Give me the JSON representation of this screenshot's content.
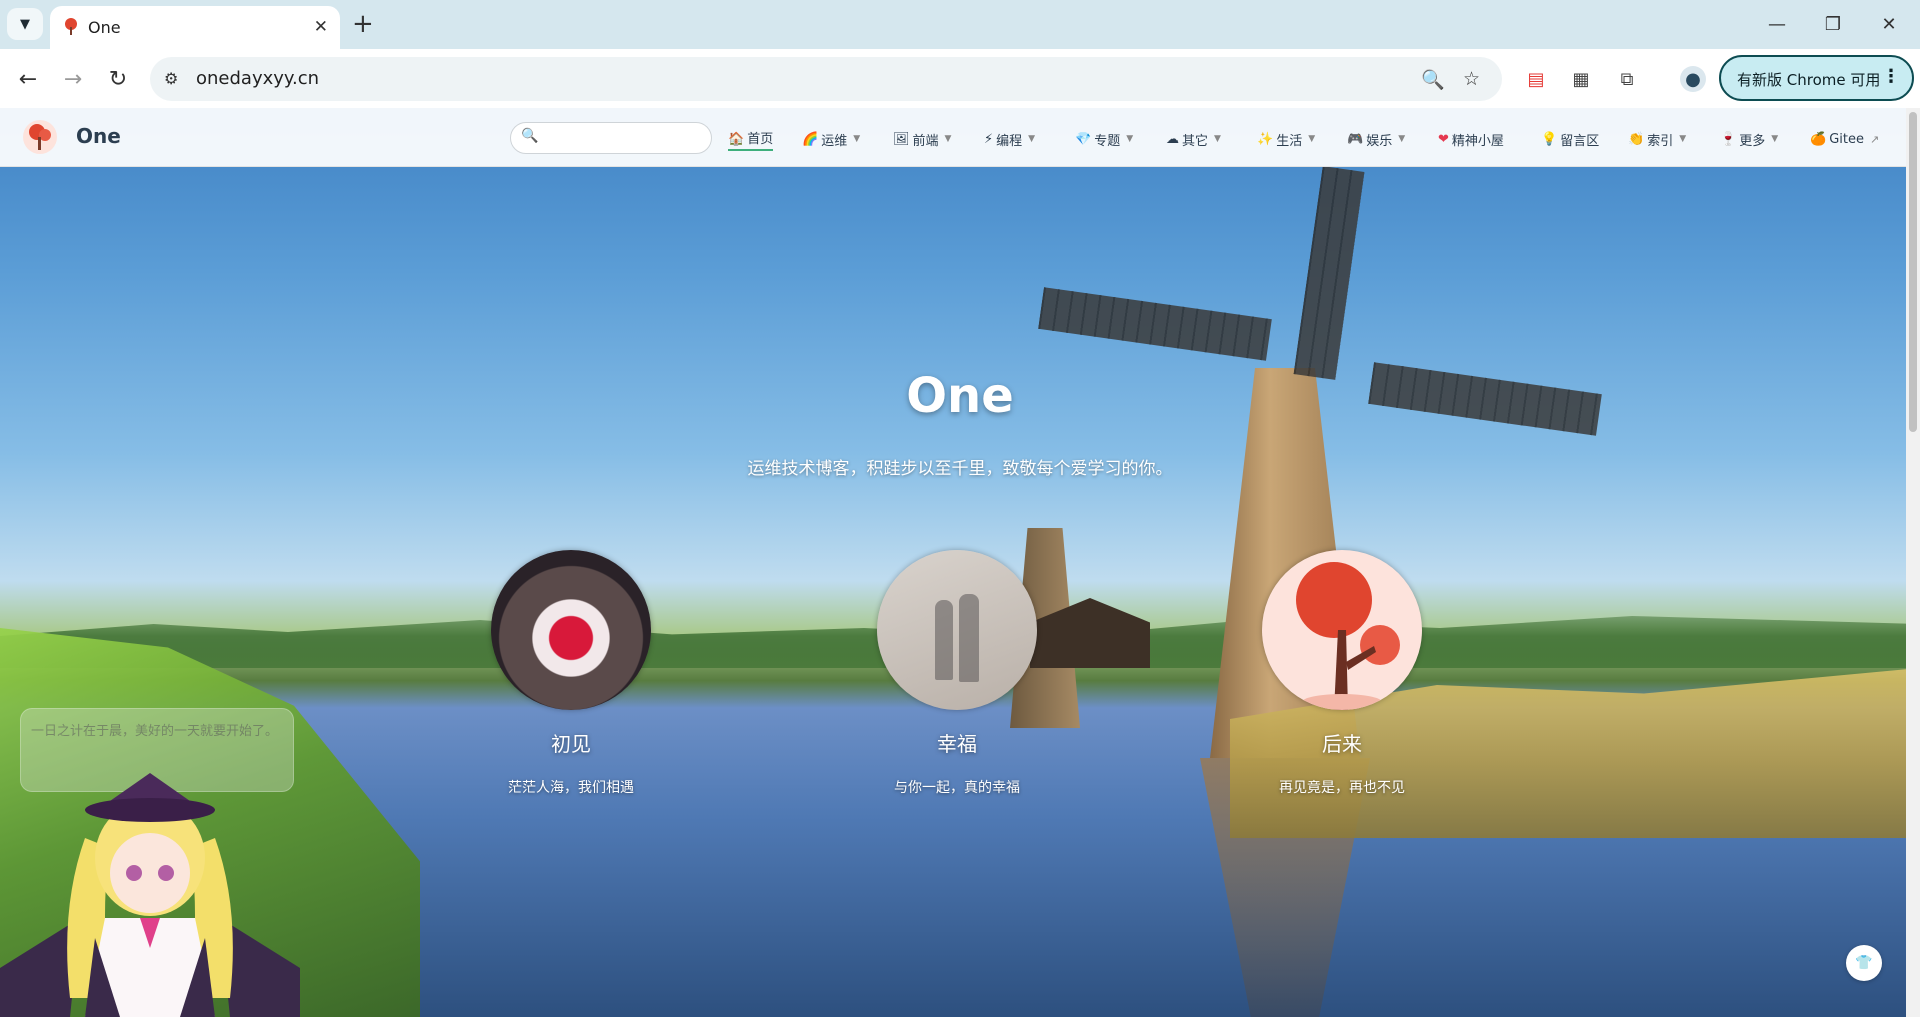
{
  "browser": {
    "tab_title": "One",
    "url": "onedayxyy.cn",
    "update_button": "有新版 Chrome 可用"
  },
  "site": {
    "name": "One",
    "search_placeholder": "",
    "nav": [
      {
        "icon": "🏠",
        "label": "首页",
        "dropdown": false,
        "active": true
      },
      {
        "icon": "🌈",
        "label": "运维",
        "dropdown": true
      },
      {
        "icon": "🖼",
        "label": "前端",
        "dropdown": true
      },
      {
        "icon": "⚡",
        "label": "编程",
        "dropdown": true
      },
      {
        "icon": "💎",
        "label": "专题",
        "dropdown": true
      },
      {
        "icon": "☁",
        "label": "其它",
        "dropdown": true
      },
      {
        "icon": "✨",
        "label": "生活",
        "dropdown": true
      },
      {
        "icon": "🎮",
        "label": "娱乐",
        "dropdown": true
      },
      {
        "icon": "❤",
        "label": "精神小屋",
        "dropdown": false
      },
      {
        "icon": "💡",
        "label": "留言区",
        "dropdown": false
      },
      {
        "icon": "👏",
        "label": "索引",
        "dropdown": true
      },
      {
        "icon": "🍷",
        "label": "更多",
        "dropdown": true
      },
      {
        "icon": "🍊",
        "label": "Gitee",
        "dropdown": false,
        "external": true
      }
    ]
  },
  "hero": {
    "title": "One",
    "subtitle": "运维技术博客，积跬步以至千里，致敬每个爱学习的你。",
    "features": [
      {
        "title": "初见",
        "desc": "茫茫人海，我们相遇"
      },
      {
        "title": "幸福",
        "desc": "与你一起，真的幸福"
      },
      {
        "title": "后来",
        "desc": "再见竟是，再也不见"
      }
    ]
  },
  "live2d": {
    "tip": "一日之计在于晨，美好的一天就要开始了。"
  },
  "icons": {
    "tab_search": "chevron-down-icon",
    "back": "arrow-left-icon",
    "forward": "arrow-right-icon",
    "reload": "reload-icon",
    "zoom": "zoom-icon",
    "bookmark": "star-icon",
    "extensions": "puzzle-icon",
    "profile": "person-icon",
    "back_to_top": "shirt-icon"
  },
  "colors": {
    "accent": "#3eaf7c",
    "update_border": "#0d4c52",
    "update_bg": "#c8ecf2"
  }
}
